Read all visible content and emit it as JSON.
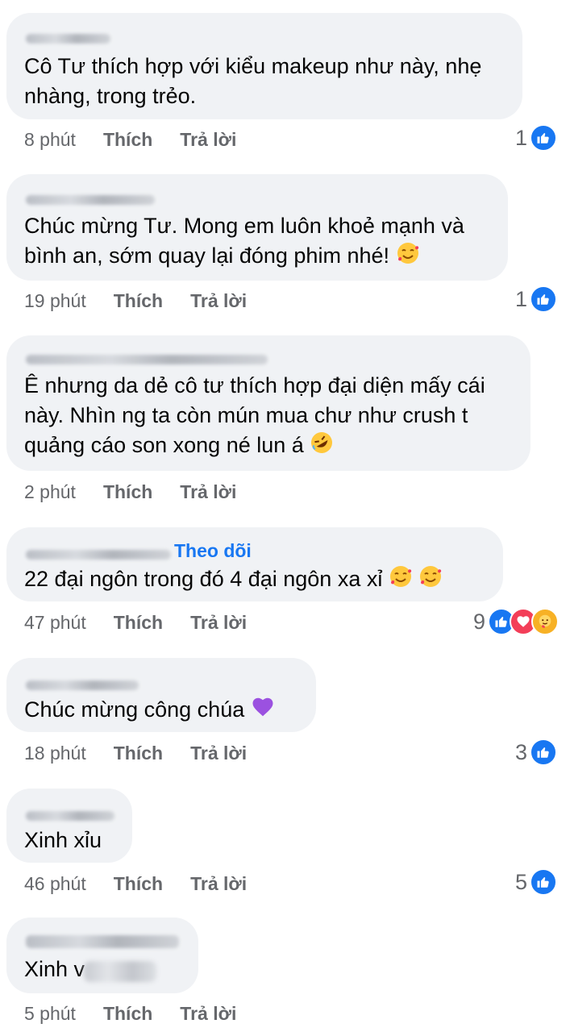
{
  "comments": [
    {
      "text_lines": [
        "Cô Tư thích hợp với kiểu makeup như này, nhẹ",
        "nhàng, trong trẻo."
      ],
      "time": "8 phút",
      "like": "Thích",
      "reply": "Trả lời",
      "reaction_count": "1",
      "reactions": [
        "like-icon"
      ]
    },
    {
      "text_lines": [
        "Chúc mừng Tư. Mong em luôn khoẻ mạnh và",
        "bình an, sớm quay lại đóng phim nhé!"
      ],
      "time": "19 phút",
      "like": "Thích",
      "reply": "Trả lời",
      "reaction_count": "1",
      "reactions": [
        "like-icon"
      ]
    },
    {
      "text_lines": [
        "Ê nhưng da dẻ cô tư thích hợp đại diện mấy cái",
        "này. Nhìn ng ta còn mún mua chư như crush t",
        "quảng cáo son xong né lun á"
      ],
      "time": "2 phút",
      "like": "Thích",
      "reply": "Trả lời"
    },
    {
      "text_lines": [
        "22 đại ngôn trong đó 4 đại ngôn xa xỉ"
      ],
      "follow": "Theo dõi",
      "time": "47 phút",
      "like": "Thích",
      "reply": "Trả lời",
      "reaction_count": "9",
      "reactions": [
        "like-icon",
        "love-icon",
        "care-icon"
      ]
    },
    {
      "text_lines": [
        "Chúc mừng công chúa"
      ],
      "time": "18 phút",
      "like": "Thích",
      "reply": "Trả lời",
      "reaction_count": "3",
      "reactions": [
        "like-icon"
      ]
    },
    {
      "text_lines": [
        "Xinh xỉu"
      ],
      "time": "46 phút",
      "like": "Thích",
      "reply": "Trả lời",
      "reaction_count": "5",
      "reactions": [
        "like-icon"
      ]
    },
    {
      "text_lines": [
        "Xinh v"
      ],
      "time": "5 phút",
      "like": "Thích",
      "reply": "Trả lời"
    }
  ],
  "colors": {
    "bubble": "#f0f2f5",
    "meta": "#65676b",
    "text": "#050505",
    "facebook_blue": "#1877f2"
  }
}
